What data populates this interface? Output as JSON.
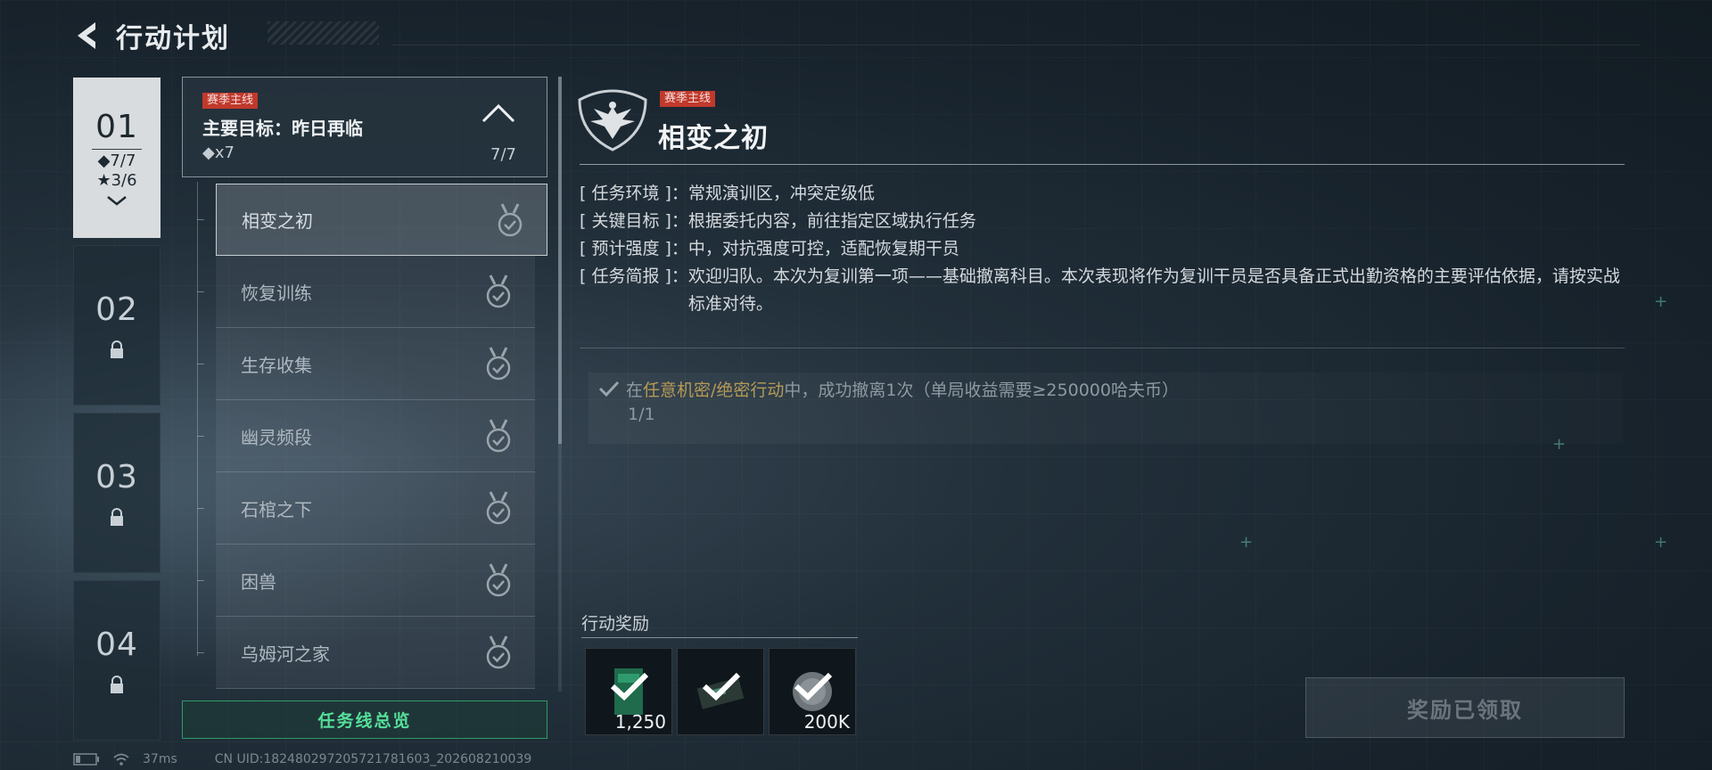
{
  "header": {
    "title": "行动计划"
  },
  "chapters": [
    {
      "num": "01",
      "diamonds": "◆7/7",
      "stars": "★3/6",
      "active": true
    },
    {
      "num": "02",
      "locked": true
    },
    {
      "num": "03",
      "locked": true
    },
    {
      "num": "04",
      "locked": true
    }
  ],
  "main_goal": {
    "tag": "赛季主线",
    "title": "主要目标：昨日再临",
    "reward": "◆x7",
    "progress": "7/7"
  },
  "sub_quests": [
    "相变之初",
    "恢复训练",
    "生存收集",
    "幽灵频段",
    "石棺之下",
    "困兽",
    "乌姆河之家"
  ],
  "overview_button": "任务线总览",
  "detail": {
    "tag": "赛季主线",
    "title": "相变之初",
    "info": [
      {
        "key": "[ 任务环境 ]：",
        "value": "常规演训区，冲突定级低"
      },
      {
        "key": "[ 关键目标 ]：",
        "value": "根据委托内容，前往指定区域执行任务"
      },
      {
        "key": "[ 预计强度 ]：",
        "value": "中，对抗强度可控，适配恢复期干员"
      },
      {
        "key": "[ 任务简报 ]：",
        "value": "欢迎归队。本次为复训第一项——基础撤离科目。本次表现将作为复训干员是否具备正式出勤资格的主要评估依据，请按实战标准对待。"
      }
    ],
    "objective": {
      "prefix": "在",
      "highlight": "任意机密/绝密行动",
      "suffix": "中，成功撤离1次（单局收益需要≥250000哈夫币）",
      "count": "1/1"
    }
  },
  "rewards": {
    "label": "行动奖励",
    "items": [
      {
        "icon": "green-card-icon",
        "qty": "1,250"
      },
      {
        "icon": "equipment-case-icon",
        "qty": ""
      },
      {
        "icon": "coin-icon",
        "qty": "200K"
      }
    ],
    "claim_button": "奖励已领取"
  },
  "status_bar": {
    "ping": "37ms",
    "uid": "CN UID:18248029720572178​1603_202608210039"
  },
  "colors": {
    "accent_green": "#55e09a",
    "tag_red": "#c0392b",
    "highlight_gold": "#b69a56"
  }
}
